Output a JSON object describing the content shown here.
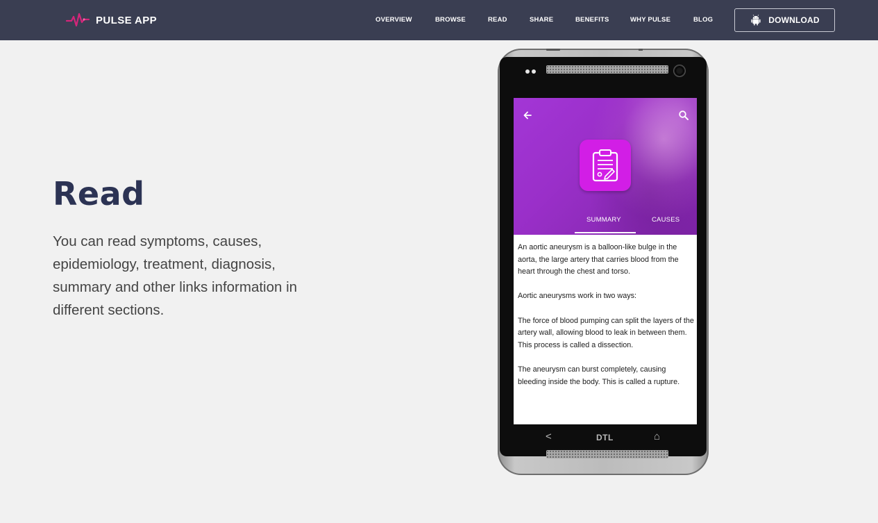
{
  "brand": {
    "name": "PULSE APP",
    "logo_icon": "heartbeat-logo-icon",
    "accent": "#d4257a"
  },
  "nav": {
    "links": [
      "OVERVIEW",
      "BROWSE",
      "READ",
      "SHARE",
      "BENEFITS",
      "WHY PULSE",
      "BLOG"
    ],
    "download_label": "DOWNLOAD",
    "download_icon": "android-icon",
    "background": "#3a3e52"
  },
  "section": {
    "title": "Read",
    "description": "You can read symptoms, causes, epidemiology, treatment, diagnosis, summary and other links information in different sections.",
    "title_color": "#2c3354"
  },
  "phone": {
    "screen": {
      "back_icon": "arrow-left-icon",
      "search_icon": "search-icon",
      "badge_icon": "clipboard-icon",
      "badge_color": "#d21ee6",
      "header_color": "#9a2fc9",
      "tabs": [
        "SUMMARY",
        "CAUSES"
      ],
      "active_tab": "SUMMARY",
      "article": [
        "An aortic aneurysm is a balloon-like bulge in the aorta, the large artery that carries blood from the heart through the chest and torso.",
        "Aortic aneurysms work in two ways:",
        "The force of blood pumping can split the layers of the artery wall, allowing blood to leak in between them. This process is called a dissection.",
        "The aneurysm can burst completely, causing bleeding inside the body. This is called a rupture."
      ]
    },
    "soft_keys": {
      "back": "<",
      "logo": "DTL",
      "home": "⌂"
    }
  }
}
